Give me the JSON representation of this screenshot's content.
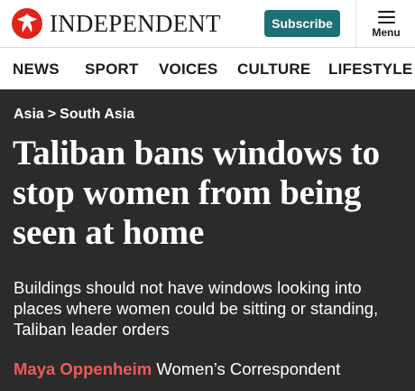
{
  "header": {
    "brand": "INDEPENDENT",
    "subscribe_label": "Subscribe",
    "menu_label": "Menu",
    "brand_color": "#e2231a",
    "subscribe_color": "#1f6f78"
  },
  "nav": {
    "items": [
      "NEWS",
      "SPORT",
      "VOICES",
      "CULTURE",
      "LIFESTYLE"
    ]
  },
  "article": {
    "breadcrumb": [
      "Asia",
      "South Asia"
    ],
    "breadcrumb_separator": ">",
    "headline": "Taliban bans windows to stop women from being seen at home",
    "standfirst": "Buildings should not have windows looking into places where women could be sitting or standing, Taliban leader orders",
    "author": "Maya Oppenheim",
    "author_role": "Women’s Correspondent",
    "author_color": "#ee5a5a"
  }
}
